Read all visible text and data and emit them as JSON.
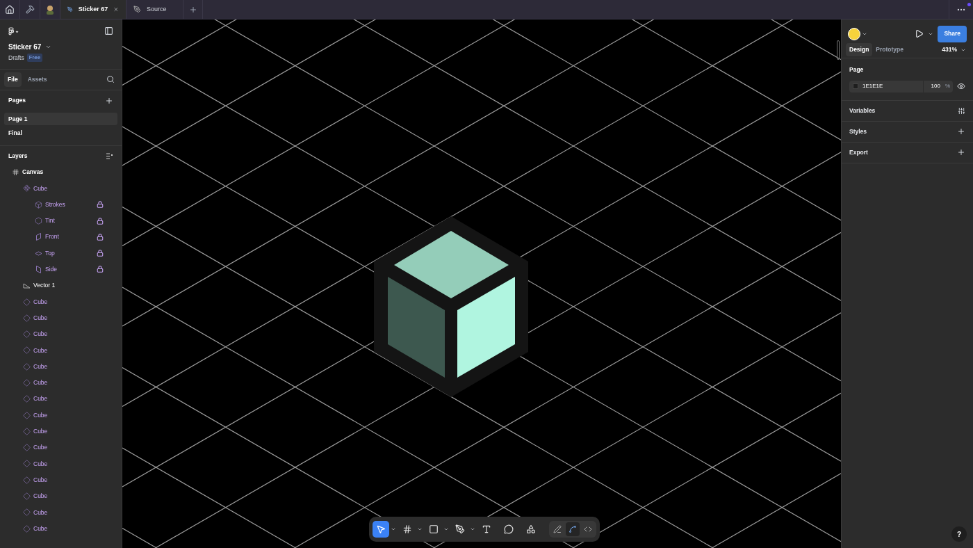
{
  "tab_bar": {
    "tabs": [
      {
        "kind": "home",
        "selected": false
      },
      {
        "kind": "tools",
        "selected": false
      },
      {
        "kind": "avatar",
        "selected": false
      },
      {
        "kind": "file",
        "label": "Sticker 67",
        "selected": true
      },
      {
        "kind": "file",
        "label": "Source",
        "selected": false
      }
    ],
    "notification": true
  },
  "left_panel": {
    "file_name": "Sticker 67",
    "location": "Drafts",
    "plan_badge": "Free",
    "panel_tabs": [
      {
        "label": "File",
        "selected": true
      },
      {
        "label": "Assets",
        "selected": false
      }
    ],
    "pages_title": "Pages",
    "pages": [
      {
        "label": "Page 1",
        "selected": true
      },
      {
        "label": "Final",
        "selected": false
      }
    ],
    "layers_title": "Layers",
    "layers": [
      {
        "name": "Canvas",
        "kind": "frame",
        "children": [
          {
            "name": "Cube",
            "kind": "component",
            "children": [
              {
                "name": "Strokes",
                "kind": "cube",
                "locked": true
              },
              {
                "name": "Tint",
                "kind": "hexagon",
                "locked": true
              },
              {
                "name": "Front",
                "kind": "front",
                "locked": true
              },
              {
                "name": "Top",
                "kind": "top",
                "locked": true
              },
              {
                "name": "Side",
                "kind": "side",
                "locked": true
              }
            ]
          },
          {
            "name": "Vector 1",
            "kind": "vector"
          },
          {
            "name": "Cube",
            "kind": "instance"
          },
          {
            "name": "Cube",
            "kind": "instance"
          },
          {
            "name": "Cube",
            "kind": "instance"
          },
          {
            "name": "Cube",
            "kind": "instance"
          },
          {
            "name": "Cube",
            "kind": "instance"
          },
          {
            "name": "Cube",
            "kind": "instance"
          },
          {
            "name": "Cube",
            "kind": "instance"
          },
          {
            "name": "Cube",
            "kind": "instance"
          },
          {
            "name": "Cube",
            "kind": "instance"
          },
          {
            "name": "Cube",
            "kind": "instance"
          },
          {
            "name": "Cube",
            "kind": "instance"
          },
          {
            "name": "Cube",
            "kind": "instance"
          },
          {
            "name": "Cube",
            "kind": "instance"
          },
          {
            "name": "Cube",
            "kind": "instance"
          },
          {
            "name": "Cube",
            "kind": "instance"
          }
        ]
      }
    ]
  },
  "toolbar": {
    "tools": [
      {
        "kind": "move",
        "selected": true,
        "dropdown": true
      },
      {
        "kind": "frame",
        "selected": false,
        "dropdown": true
      },
      {
        "kind": "rectangle",
        "selected": false,
        "dropdown": true
      },
      {
        "kind": "pen",
        "selected": false,
        "dropdown": true
      },
      {
        "kind": "text",
        "selected": false,
        "dropdown": false
      },
      {
        "kind": "comment",
        "selected": false,
        "dropdown": false
      },
      {
        "kind": "actions",
        "selected": false,
        "dropdown": false
      }
    ],
    "modes": [
      {
        "kind": "draw",
        "selected": false
      },
      {
        "kind": "design",
        "selected": true
      },
      {
        "kind": "dev",
        "selected": false
      }
    ]
  },
  "help_label": "?",
  "right_panel": {
    "share_label": "Share",
    "tabs": [
      {
        "label": "Design",
        "selected": true
      },
      {
        "label": "Prototype",
        "selected": false
      }
    ],
    "zoom": "431%",
    "page_title": "Page",
    "page_color": {
      "color": "#1e1e1e",
      "hex": "1E1E1E",
      "opacity": "100",
      "unit": "%"
    },
    "sections": [
      {
        "label": "Variables",
        "kind": "variables"
      },
      {
        "label": "Styles",
        "kind": "add"
      },
      {
        "label": "Export",
        "kind": "add"
      }
    ]
  }
}
